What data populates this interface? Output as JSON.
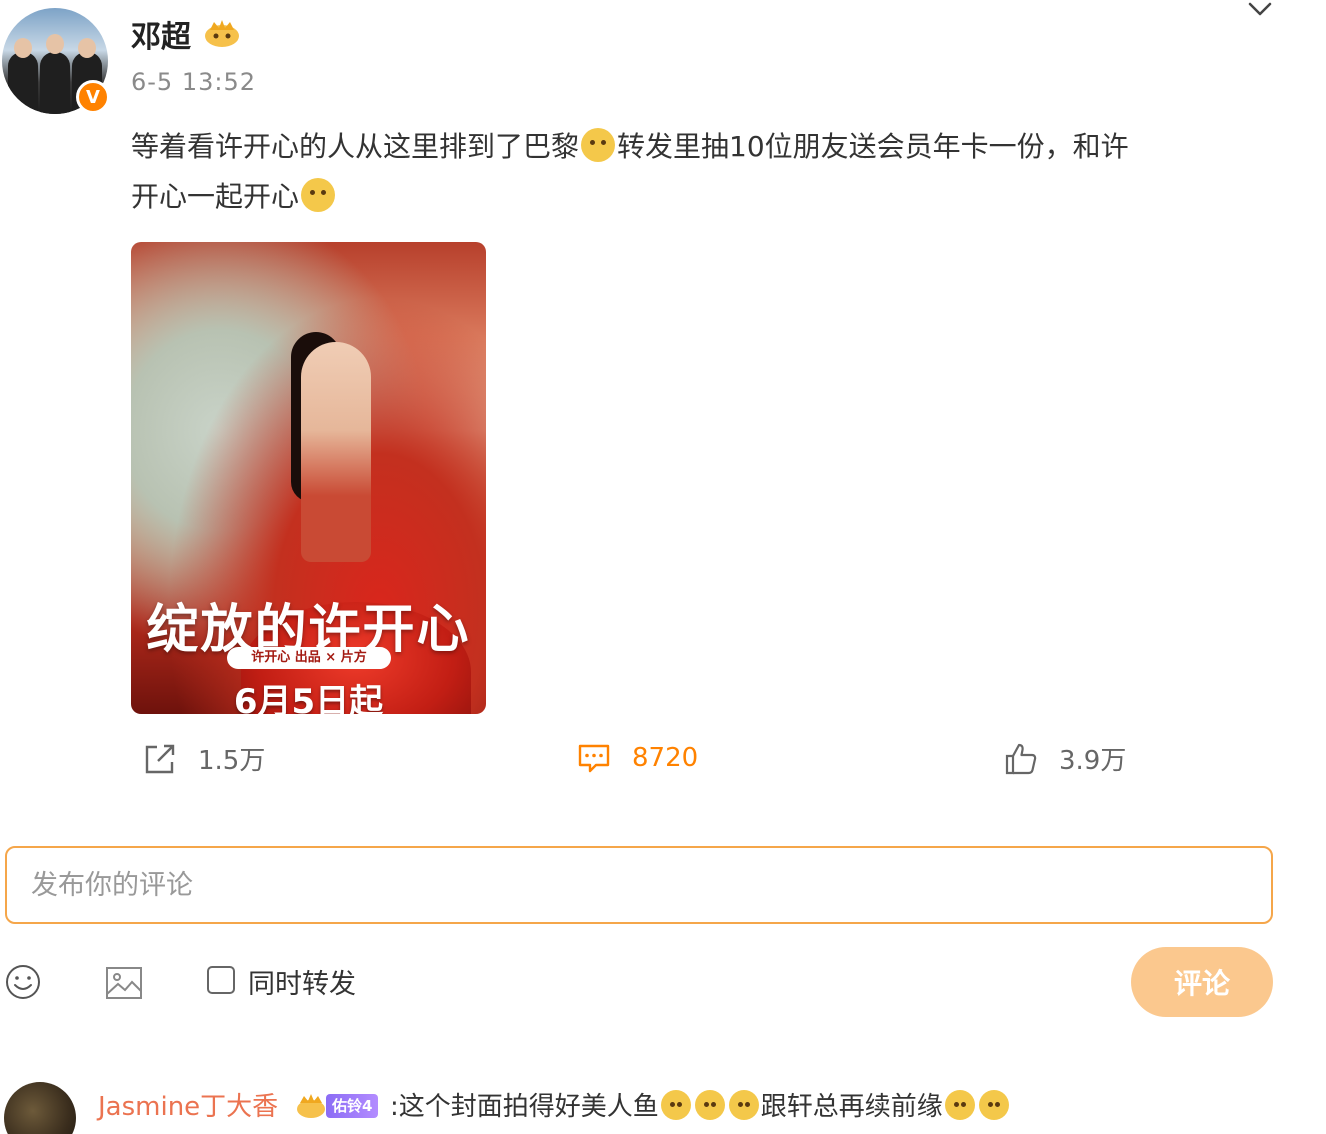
{
  "post": {
    "username": "邓超",
    "timestamp": "6-5 13:52",
    "text_line1_part1": "等着看许开心的人从这里排到了巴黎",
    "text_line1_part2": "转发里抽10位朋友送会员年卡一份，和许",
    "text_line2": "开心一起开心",
    "poster": {
      "title": "绽放的许开心",
      "banner": "许开心 出品 × 片方",
      "date": "6月5日起"
    }
  },
  "actions": {
    "repost_count": "1.5万",
    "comment_count": "8720",
    "like_count": "3.9万"
  },
  "composer": {
    "placeholder": "发布你的评论",
    "repost_label": "同时转发",
    "submit_label": "评论"
  },
  "comment": {
    "user": "Jasmine丁大香",
    "level_badge": "佑铃4",
    "text_part1": ":这个封面拍得好美人鱼",
    "text_part2": "跟轩总再续前缘"
  },
  "colors": {
    "accent": "#ff8200",
    "input_border": "#f5a64a",
    "submit_bg": "#fbc88e",
    "comment_user": "#eb7350"
  },
  "icons": [
    "crown-icon",
    "verified-icon",
    "chevron-down-icon",
    "repost-icon",
    "comment-icon",
    "like-icon",
    "emoji-icon",
    "image-icon"
  ]
}
